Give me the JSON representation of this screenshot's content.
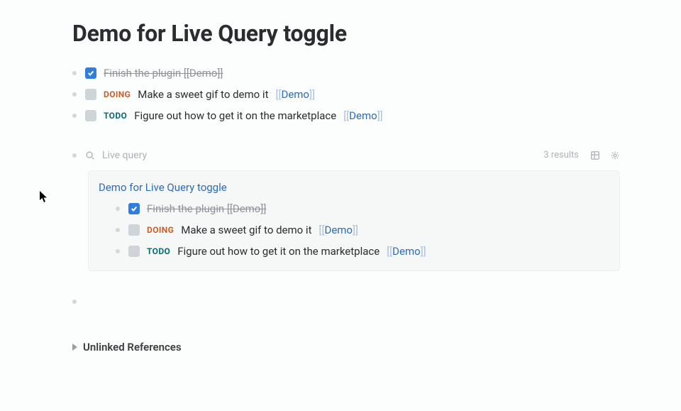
{
  "page": {
    "title": "Demo for Live Query toggle"
  },
  "tasks": [
    {
      "status_label": "",
      "text": "Finish the plugin",
      "ref": "Demo",
      "done": true
    },
    {
      "status_label": "DOING",
      "text": "Make a sweet gif to demo it",
      "ref": "Demo",
      "done": false
    },
    {
      "status_label": "TODO",
      "text": "Figure out how to get it on the marketplace",
      "ref": "Demo",
      "done": false
    }
  ],
  "query": {
    "label": "Live query",
    "results_text": "3 results",
    "result_page_title": "Demo for Live Query toggle",
    "items": [
      {
        "status_label": "",
        "text": "Finish the plugin",
        "ref": "Demo",
        "done": true
      },
      {
        "status_label": "DOING",
        "text": "Make a sweet gif to demo it",
        "ref": "Demo",
        "done": false
      },
      {
        "status_label": "TODO",
        "text": "Figure out how to get it on the marketplace",
        "ref": "Demo",
        "done": false
      }
    ]
  },
  "unlinked_refs_label": "Unlinked References"
}
